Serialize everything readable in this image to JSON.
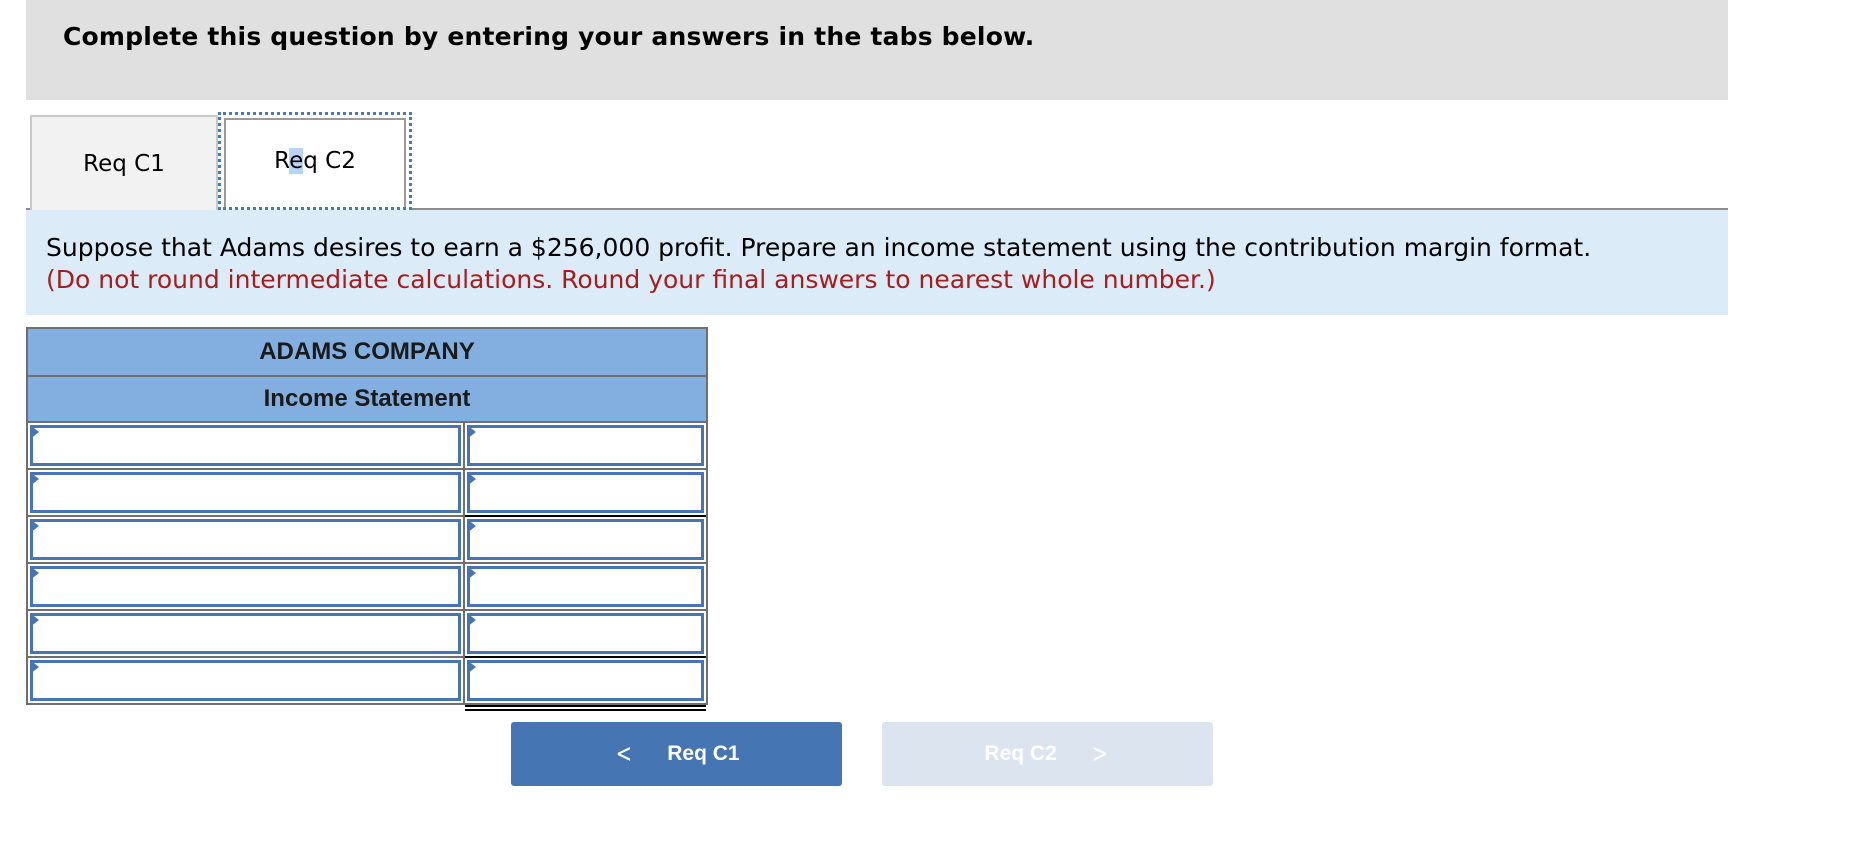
{
  "header": {
    "title": "Complete this question by entering your answers in the tabs below."
  },
  "tabs": [
    {
      "label_pre": "Req C1",
      "active": false
    },
    {
      "label_pre": "R",
      "label_sel": "e",
      "label_post": "q C2",
      "active": true
    }
  ],
  "prompt": {
    "text": "Suppose that Adams desires to earn a $256,000 profit. Prepare an income statement using the contribution margin format.",
    "note": "(Do not round intermediate calculations. Round your final answers to nearest whole number.)"
  },
  "statement": {
    "company": "ADAMS COMPANY",
    "title": "Income Statement",
    "rows": [
      {
        "label": "",
        "value": ""
      },
      {
        "label": "",
        "value": ""
      },
      {
        "label": "",
        "value": ""
      },
      {
        "label": "",
        "value": ""
      },
      {
        "label": "",
        "value": ""
      },
      {
        "label": "",
        "value": ""
      }
    ]
  },
  "navigation": {
    "prev_label": "Req C1",
    "next_label": "Req C2",
    "prev_icon": "chevron-left-icon",
    "next_icon": "chevron-right-icon",
    "next_disabled": true
  },
  "colors": {
    "header_bg": "#e0e0e0",
    "prompt_bg": "#dcebf8",
    "note_red": "#a51e1e",
    "table_header_bg": "#82aee0",
    "input_border": "#4774b4",
    "prev_button": "#4675b4",
    "next_button_disabled": "#dbe4ef"
  }
}
